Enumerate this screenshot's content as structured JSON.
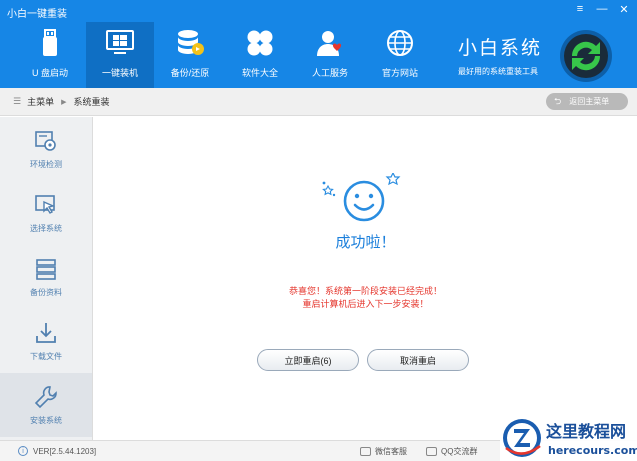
{
  "window": {
    "title": "小白一键重装",
    "controls": [
      "≡",
      "—",
      "✕"
    ]
  },
  "nav": [
    {
      "label": "U 盘启动",
      "icon": "usb-drive-icon"
    },
    {
      "label": "一键装机",
      "icon": "monitor-windows-icon"
    },
    {
      "label": "备份/还原",
      "icon": "database-backup-icon"
    },
    {
      "label": "软件大全",
      "icon": "clover-apps-icon"
    },
    {
      "label": "人工服务",
      "icon": "support-person-icon"
    },
    {
      "label": "官方网站",
      "icon": "globe-icon"
    }
  ],
  "brand": {
    "name": "小白系统",
    "slogan": "最好用的系统重装工具"
  },
  "breadcrumb": {
    "root": "主菜单",
    "current": "系统重装",
    "back_label": "返回主菜单"
  },
  "sidebar": [
    {
      "label": "环境检测",
      "icon": "environment-check-icon"
    },
    {
      "label": "选择系统",
      "icon": "select-system-icon"
    },
    {
      "label": "备份资料",
      "icon": "backup-data-icon"
    },
    {
      "label": "下载文件",
      "icon": "download-file-icon"
    },
    {
      "label": "安装系统",
      "icon": "wrench-install-icon"
    }
  ],
  "main": {
    "success_text": "成功啦！",
    "message_line1": "恭喜您！系统第一阶段安装已经完成！",
    "message_line2": "重启计算机后进入下一步安装！",
    "restart_button": "立即重启(6)",
    "cancel_button": "取消重启"
  },
  "footer": {
    "version": "VER[2.5.44.1203]",
    "wechat": "微信客服",
    "qq": "QQ交流群"
  },
  "watermark": {
    "title": "这里教程网",
    "site": "herecours.com"
  },
  "colors": {
    "header": "#1686e6",
    "active_nav": "#0f6fc4",
    "accent": "#1b7fdb",
    "message": "#e5362d"
  }
}
